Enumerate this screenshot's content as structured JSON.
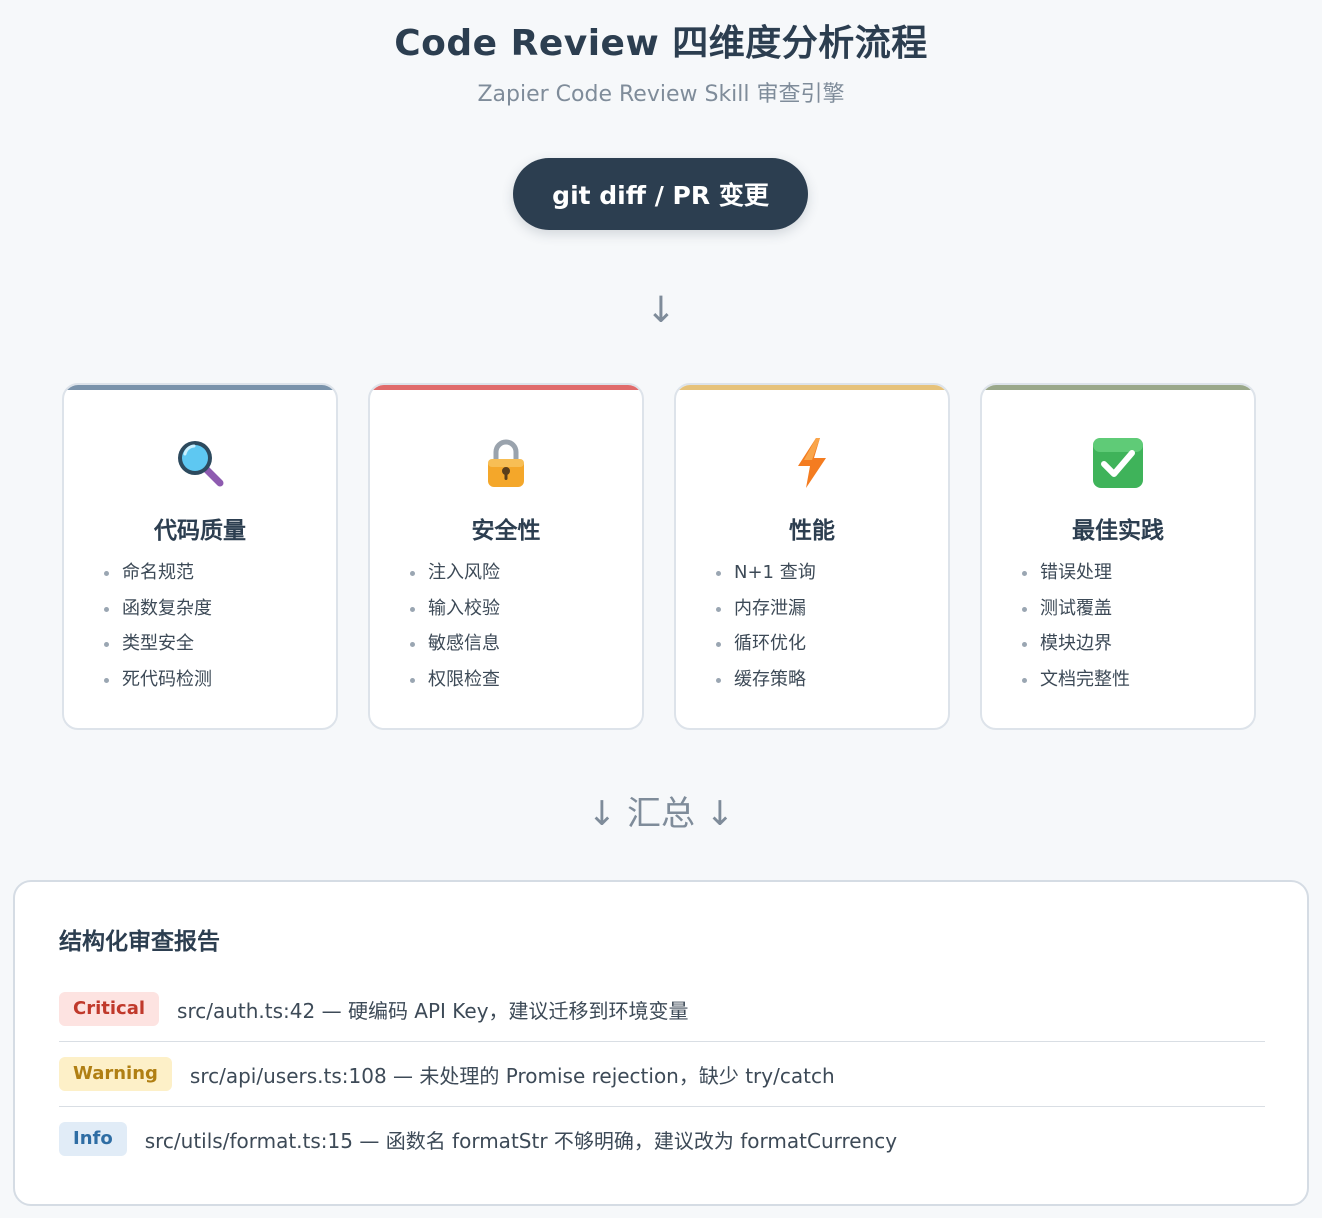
{
  "header": {
    "title": "Code Review 四维度分析流程",
    "subtitle": "Zapier Code Review Skill 审查引擎"
  },
  "flow": {
    "start": "git diff / PR 变更",
    "arrow": "↓",
    "summary": "↓ 汇总 ↓"
  },
  "dimensions": [
    {
      "icon": "magnifier-icon",
      "accent": "#7a93ab",
      "title": "代码质量",
      "items": [
        "命名规范",
        "函数复杂度",
        "类型安全",
        "死代码检测"
      ]
    },
    {
      "icon": "lock-icon",
      "accent": "#e06b6b",
      "title": "安全性",
      "items": [
        "注入风险",
        "输入校验",
        "敏感信息",
        "权限检查"
      ]
    },
    {
      "icon": "lightning-icon",
      "accent": "#e6c27a",
      "title": "性能",
      "items": [
        "N+1 查询",
        "内存泄漏",
        "循环优化",
        "缓存策略"
      ]
    },
    {
      "icon": "checkmark-icon",
      "accent": "#9aa88a",
      "title": "最佳实践",
      "items": [
        "错误处理",
        "测试覆盖",
        "模块边界",
        "文档完整性"
      ]
    }
  ],
  "report": {
    "title": "结构化审查报告",
    "rows": [
      {
        "level": "Critical",
        "text": "src/auth.ts:42 — 硬编码 API Key，建议迁移到环境变量"
      },
      {
        "level": "Warning",
        "text": "src/api/users.ts:108 — 未处理的 Promise rejection，缺少 try/catch"
      },
      {
        "level": "Info",
        "text": "src/utils/format.ts:15 — 函数名 formatStr 不够明确，建议改为 formatCurrency"
      }
    ]
  },
  "colors": {
    "primary": "#2c3e50",
    "critical": "#c0392b",
    "warning": "#b07f13",
    "info": "#2e6da4"
  }
}
